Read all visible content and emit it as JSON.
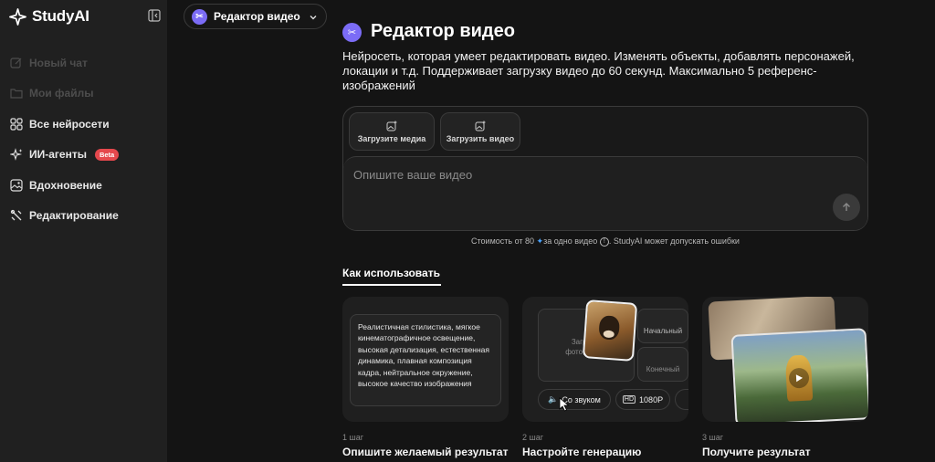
{
  "app": {
    "name": "StudyAI"
  },
  "sidebar": {
    "items": [
      {
        "label": "Новый чат",
        "icon": "edit-icon"
      },
      {
        "label": "Мои файлы",
        "icon": "folder-icon"
      },
      {
        "label": "Все нейросети",
        "icon": "grid-icon"
      },
      {
        "label": "ИИ-агенты",
        "icon": "sparkle-icon",
        "badge": "Beta"
      },
      {
        "label": "Вдохновение",
        "icon": "image-icon"
      },
      {
        "label": "Редактирование",
        "icon": "tools-icon"
      }
    ]
  },
  "model_selector": {
    "label": "Редактор видео"
  },
  "header": {
    "title": "Редактор видео",
    "description": "Нейросеть, которая умеет редактировать видео. Изменять объекты, добавлять персонажей, локации и т.д. Поддерживает загрузку видео до 60 секунд. Максимально 5 референс-изображений"
  },
  "composer": {
    "upload_media_label": "Загрузите медиа",
    "upload_video_label": "Загрузить видео",
    "placeholder": "Опишите ваше видео"
  },
  "cost_note": {
    "prefix": "Стоимость от 80",
    "suffix": "за одно видео",
    "tail": ". StudyAI может допускать ошибки"
  },
  "how_to": {
    "heading": "Как использовать",
    "steps": [
      {
        "step": "1 шаг",
        "title": "Опишите желаемый результат"
      },
      {
        "step": "2 шаг",
        "title": "Настройте генерацию"
      },
      {
        "step": "3 шаг",
        "title": "Получите результат"
      }
    ],
    "card1_text": "Реалистичная стилистика, мягкое кинематографичное освещение, высокая детализация, естественная динамика, плавная композиция кадра, нейтральное окружение, высокое качество изображения",
    "card2": {
      "upload_text_1": "Загрузит",
      "upload_text_2": "фото, видео",
      "start_frame": "Начальный",
      "end_frame": "Конечный",
      "sound_label": "Со звуком",
      "resolution_label": "1080P"
    }
  },
  "colors": {
    "accent": "#7b6cf6",
    "badge": "#e5484d",
    "background": "#141414",
    "sidebar": "#202020"
  }
}
